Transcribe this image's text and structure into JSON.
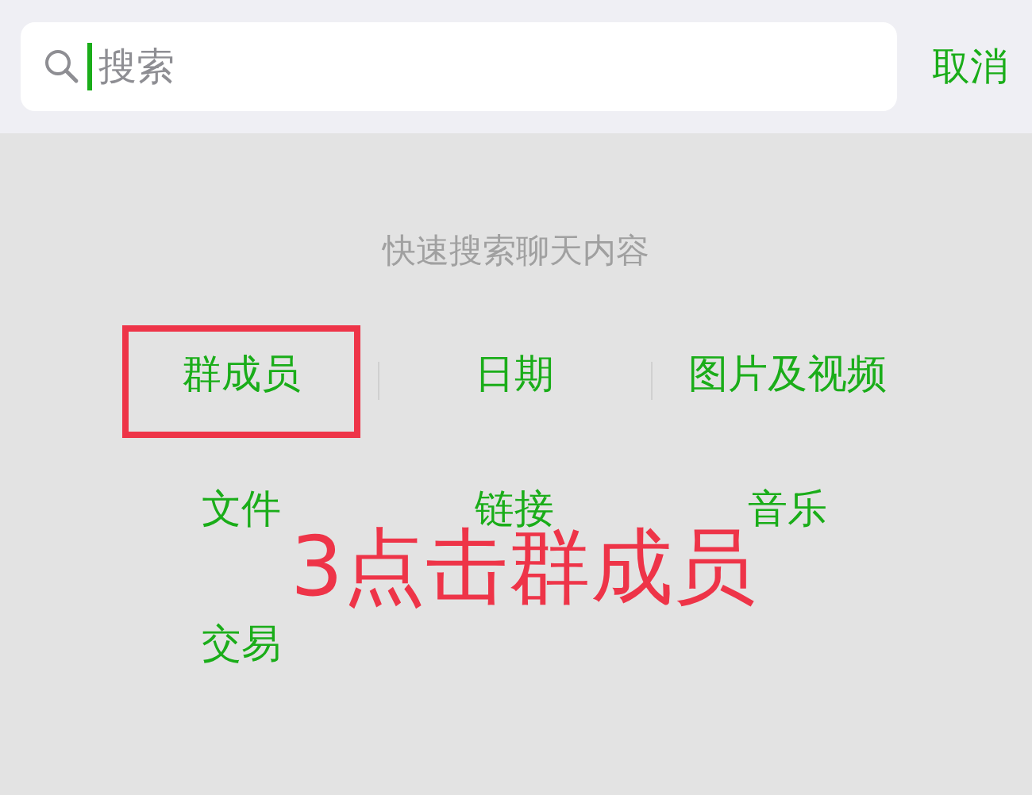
{
  "search": {
    "placeholder": "搜索",
    "cancel": "取消"
  },
  "hint": "快速搜索聊天内容",
  "categories": [
    [
      {
        "label": "群成员",
        "highlighted": true
      },
      {
        "label": "日期",
        "highlighted": false
      },
      {
        "label": "图片及视频",
        "highlighted": false
      }
    ],
    [
      {
        "label": "文件",
        "highlighted": false
      },
      {
        "label": "链接",
        "highlighted": false
      },
      {
        "label": "音乐",
        "highlighted": false
      }
    ],
    [
      {
        "label": "交易",
        "highlighted": false
      }
    ]
  ],
  "annotation": "3点击群成员"
}
